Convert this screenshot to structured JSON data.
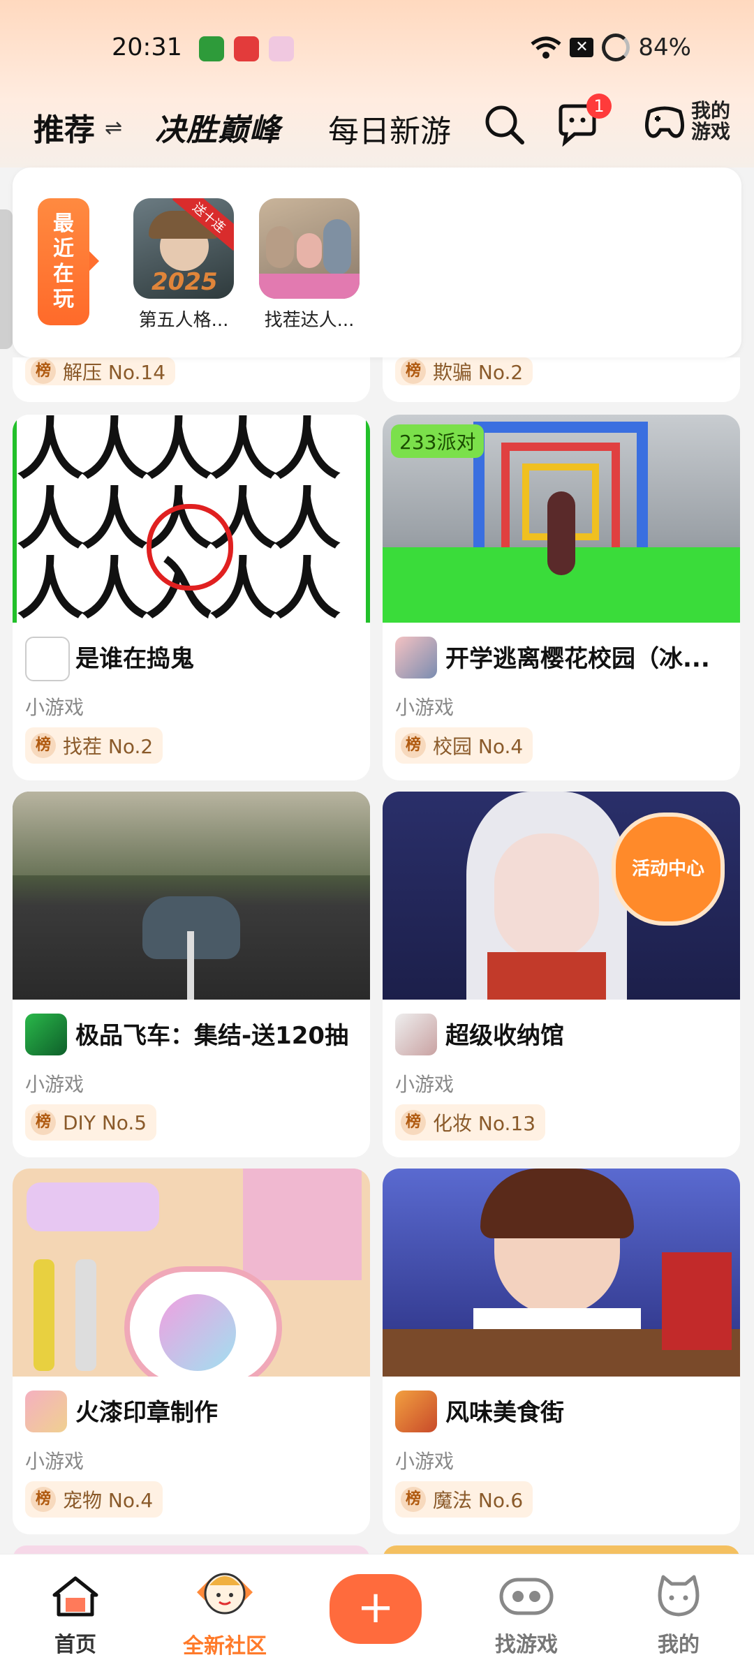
{
  "status": {
    "time": "20:31",
    "battery": "84%"
  },
  "header": {
    "tab_recommend": "推荐",
    "tab_battle": "决胜巅峰",
    "tab_daily": "每日新游",
    "notification_count": "1",
    "my_games": "我的游戏"
  },
  "recent": {
    "label": "最近在玩",
    "games": [
      {
        "name": "第五人格...",
        "ribbon": "送十连",
        "year": "2025"
      },
      {
        "name": "找茬达人..."
      }
    ]
  },
  "partial_ranks": [
    "解压 No.14",
    "欺骗 No.2"
  ],
  "rank_prefix": "榜",
  "cards": [
    {
      "title": "是谁在捣鬼",
      "sub": "小游戏",
      "rank": "找茬 No.2"
    },
    {
      "title": "开学逃离樱花校园（冰...",
      "sub": "小游戏",
      "rank": "校园 No.4",
      "tag": "233派对"
    },
    {
      "title": "极品飞车：集结-送120抽",
      "sub": "小游戏",
      "rank": "DIY No.5"
    },
    {
      "title": "超级收纳馆",
      "sub": "小游戏",
      "rank": "化妆 No.13",
      "badge": "活动中心"
    },
    {
      "title": "火漆印章制作",
      "sub": "小游戏",
      "rank": "宠物 No.4"
    },
    {
      "title": "风味美食街",
      "sub": "小游戏",
      "rank": "魔法 No.6"
    }
  ],
  "bottom_nav": {
    "home": "首页",
    "community": "全新社区",
    "plus": "+",
    "find_games": "找游戏",
    "mine": "我的"
  }
}
